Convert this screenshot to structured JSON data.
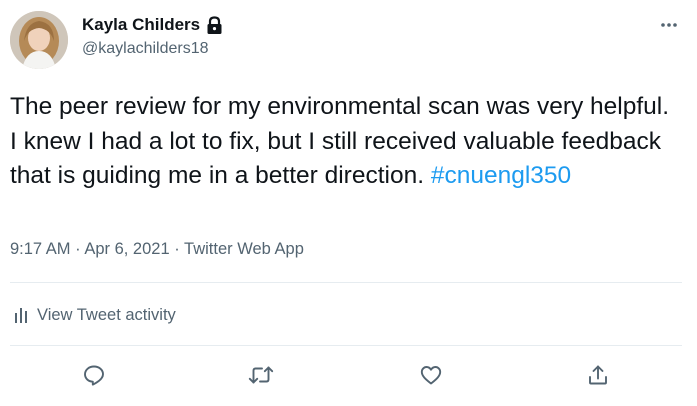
{
  "author": {
    "display_name": "Kayla Childers",
    "handle": "@kaylachilders18",
    "protected": true
  },
  "tweet": {
    "text_main": "The peer review for my environmental scan was very helpful. I knew I had a lot to fix, but I still received valuable feedback that is guiding me in a better direction.",
    "hashtag": "#cnuengl350",
    "time": "9:17 AM",
    "separator": "·",
    "date": "Apr 6, 2021",
    "source": "Twitter Web App"
  },
  "activity": {
    "label": "View Tweet activity"
  },
  "actions": [
    "reply",
    "retweet",
    "like",
    "share"
  ],
  "icons": {
    "more": "more-horizontal-icon",
    "lock": "lock-icon",
    "activity": "bar-chart-icon",
    "reply": "reply-icon",
    "retweet": "retweet-icon",
    "like": "heart-icon",
    "share": "share-icon"
  },
  "colors": {
    "text": "#0f1419",
    "secondary": "#536471",
    "link": "#1d9bf0",
    "divider": "#e6ecf0"
  }
}
